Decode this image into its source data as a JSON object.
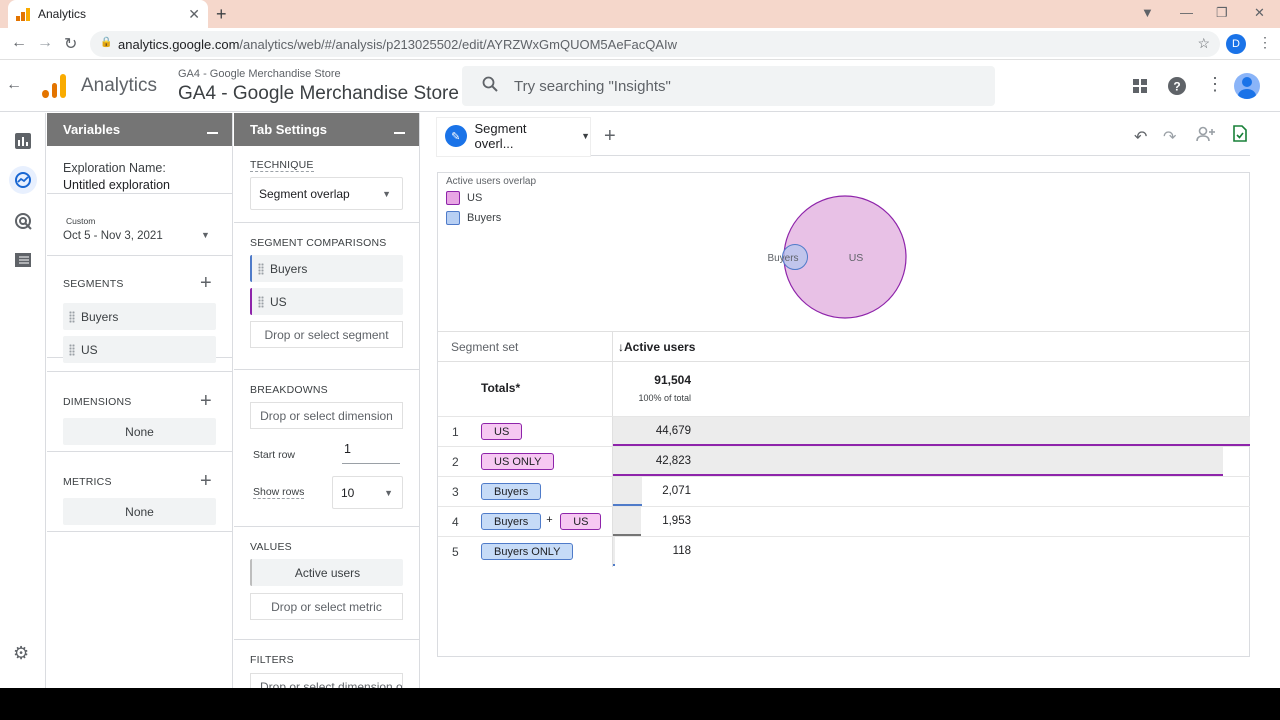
{
  "browser": {
    "tab_title": "Analytics",
    "url_host": "analytics.google.com",
    "url_path": "/analytics/web/#/analysis/p213025502/edit/AYRZWxGmQUOM5AeFacQAIw",
    "profile_letter": "D"
  },
  "header": {
    "product": "Analytics",
    "account_small": "GA4 - Google Merchandise Store",
    "account_big": "GA4 - Google Merchandise Store",
    "search_placeholder": "Try searching \"Insights\""
  },
  "variables": {
    "title": "Variables",
    "exploration_label": "Exploration Name:",
    "exploration_name": "Untitled exploration",
    "date_custom": "Custom",
    "date_range": "Oct 5 - Nov 3, 2021",
    "segments_title": "SEGMENTS",
    "segments": [
      "Buyers",
      "US"
    ],
    "dimensions_title": "DIMENSIONS",
    "dimensions_none": "None",
    "metrics_title": "METRICS",
    "metrics_none": "None"
  },
  "tab_settings": {
    "title": "Tab Settings",
    "technique_title": "TECHNIQUE",
    "technique_value": "Segment overlap",
    "segment_comparisons_title": "SEGMENT COMPARISONS",
    "segment_comparisons": [
      "Buyers",
      "US"
    ],
    "drop_segment": "Drop or select segment",
    "breakdowns_title": "BREAKDOWNS",
    "drop_dimension": "Drop or select dimension",
    "start_row_label": "Start row",
    "start_row_value": "1",
    "show_rows_label": "Show rows",
    "show_rows_value": "10",
    "values_title": "VALUES",
    "values_item": "Active users",
    "drop_metric": "Drop or select metric",
    "filters_title": "FILTERS",
    "drop_filter": "Drop or select dimension or"
  },
  "canvas": {
    "tab_label": "Segment overl...",
    "legend_title": "Active users overlap",
    "legend": [
      {
        "name": "US",
        "color": "#e8a6e4"
      },
      {
        "name": "Buyers",
        "color": "#b7cff3"
      }
    ],
    "venn_labels": {
      "small": "Buyers",
      "large": "US"
    },
    "table": {
      "col_segment": "Segment set",
      "col_metric": "Active users",
      "totals_label": "Totals*",
      "totals_value": "91,504",
      "totals_pct": "100% of total",
      "rows": [
        {
          "n": "1",
          "parts": [
            "US"
          ],
          "value": "44,679",
          "fraction": 1.0,
          "color": "#8e24aa"
        },
        {
          "n": "2",
          "parts": [
            "US ONLY"
          ],
          "value": "42,823",
          "fraction": 0.958,
          "color": "#8e24aa"
        },
        {
          "n": "3",
          "parts": [
            "Buyers"
          ],
          "value": "2,071",
          "fraction": 0.046,
          "color": "#4f7bc9"
        },
        {
          "n": "4",
          "parts": [
            "Buyers",
            "US"
          ],
          "value": "1,953",
          "fraction": 0.044,
          "color": "#757575"
        },
        {
          "n": "5",
          "parts": [
            "Buyers ONLY"
          ],
          "value": "118",
          "fraction": 0.003,
          "color": "#4f7bc9"
        }
      ],
      "plus_sign": "+"
    }
  },
  "colors": {
    "us_fill": "#e8a6e4",
    "us_border": "#8e24aa",
    "buyers_fill": "#b7cff3",
    "buyers_border": "#4f7bc9",
    "accent": "#1a73e8"
  }
}
